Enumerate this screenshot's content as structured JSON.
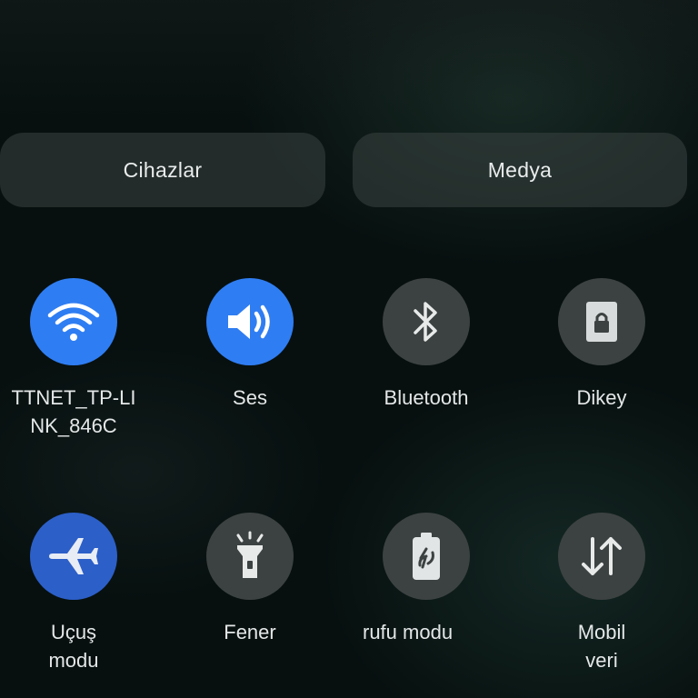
{
  "segments": {
    "left_label": "Cihazlar",
    "right_label": "Medya"
  },
  "tiles": [
    {
      "label": "TTNET_TP-LI\nNK_846C",
      "icon": "wifi-icon",
      "state": "on"
    },
    {
      "label": "Ses",
      "icon": "volume-icon",
      "state": "on"
    },
    {
      "label": "Bluetooth",
      "icon": "bluetooth-icon",
      "state": "off"
    },
    {
      "label": "Dikey",
      "icon": "rotation-lock-icon",
      "state": "off"
    },
    {
      "label": "Uçuş\nmodu",
      "icon": "airplane-icon",
      "state": "on"
    },
    {
      "label": "Fener",
      "icon": "flashlight-icon",
      "state": "off"
    },
    {
      "label": "rufu modu",
      "icon": "battery-saver-icon",
      "state": "off"
    },
    {
      "label": "Mobil\nveri",
      "icon": "mobile-data-icon",
      "state": "off"
    }
  ],
  "colors": {
    "active": "#2f7df2",
    "active_dim": "#2c5fc8",
    "inactive": "#3c4241",
    "background": "#07100f"
  }
}
